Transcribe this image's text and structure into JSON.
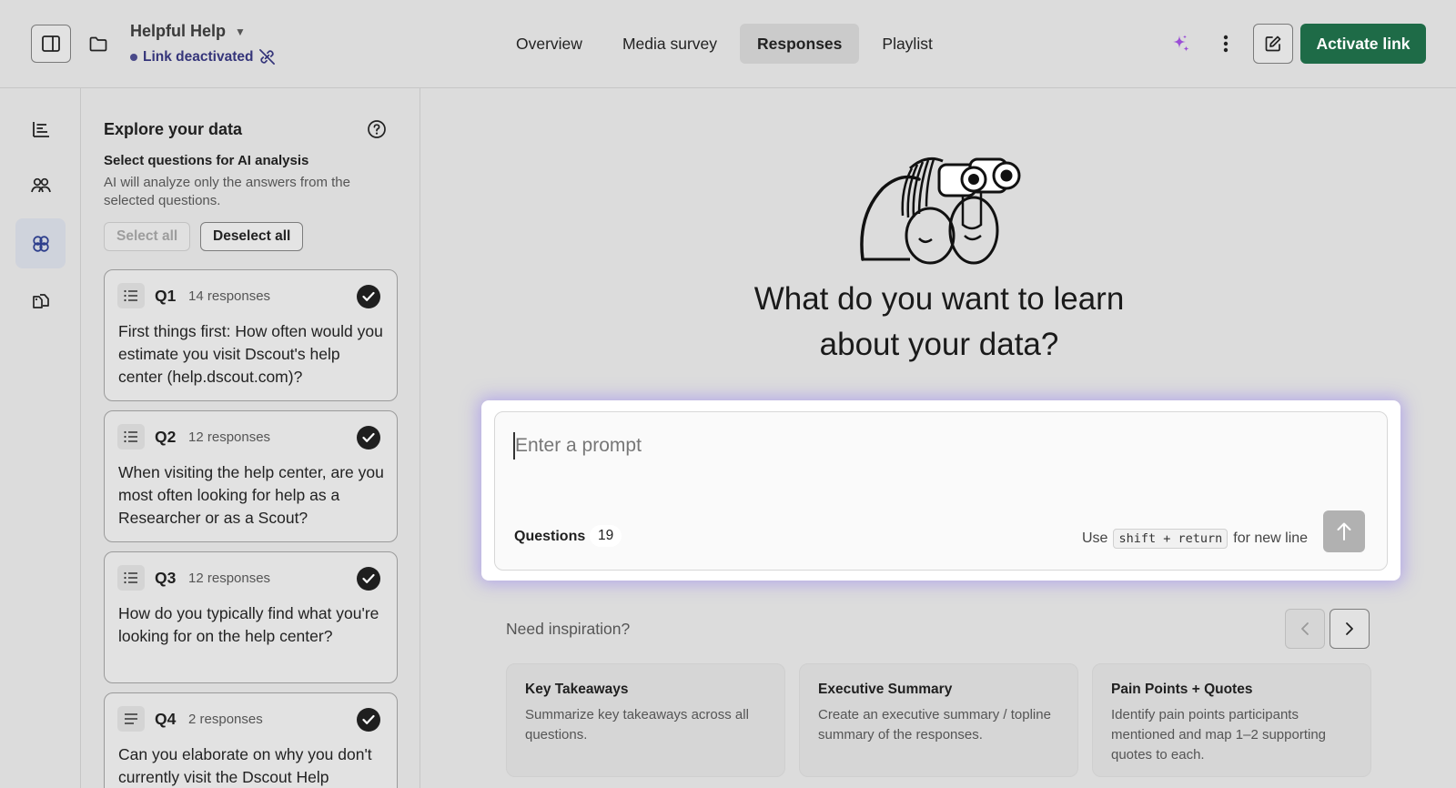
{
  "header": {
    "project_title": "Helpful Help",
    "link_status": "Link deactivated",
    "tabs": [
      {
        "label": "Overview",
        "active": false
      },
      {
        "label": "Media survey",
        "active": false
      },
      {
        "label": "Responses",
        "active": true
      },
      {
        "label": "Playlist",
        "active": false
      }
    ],
    "activate_label": "Activate link"
  },
  "sidebar": {
    "items": [
      {
        "icon": "bar-chart-icon",
        "active": false
      },
      {
        "icon": "people-icon",
        "active": false
      },
      {
        "icon": "ai-analysis-icon",
        "active": true
      },
      {
        "icon": "tags-icon",
        "active": false
      }
    ]
  },
  "explore": {
    "title": "Explore your data",
    "select_heading": "Select questions for AI analysis",
    "select_description": "AI will analyze only the answers from the selected questions.",
    "select_all_label": "Select all",
    "deselect_all_label": "Deselect all",
    "questions": [
      {
        "id": "Q1",
        "responses": "14 responses",
        "text": "First things first: How often would you estimate you visit Dscout's help center (help.dscout.com)?",
        "checked": true
      },
      {
        "id": "Q2",
        "responses": "12 responses",
        "text": "When visiting the help center, are you most often looking for help as a Researcher or as a Scout?",
        "checked": true
      },
      {
        "id": "Q3",
        "responses": "12 responses",
        "text": "How do you typically find what you're looking for on the help center?",
        "checked": true
      },
      {
        "id": "Q4",
        "responses": "2 responses",
        "text": "Can you elaborate on why you don't currently visit the Dscout Help",
        "checked": true
      }
    ]
  },
  "main": {
    "headline_line1": "What do you want to learn",
    "headline_line2": "about your data?",
    "prompt_placeholder": "Enter a prompt",
    "prompt_value": "",
    "questions_label": "Questions",
    "questions_count": "19",
    "hint_prefix": "Use",
    "hint_key": "shift + return",
    "hint_suffix": "for new line",
    "inspiration_label": "Need inspiration?",
    "suggestions": [
      {
        "title": "Key Takeaways",
        "body": "Summarize key takeaways across all questions."
      },
      {
        "title": "Executive Summary",
        "body": "Create an executive summary / topline summary of the responses."
      },
      {
        "title": "Pain Points + Quotes",
        "body": "Identify pain points participants mentioned and map 1–2 supporting quotes to each."
      }
    ]
  },
  "colors": {
    "accent_green": "#1e6b47",
    "sparkle_purple": "#9b4fd6",
    "prompt_glow": "#9682f0",
    "background": "#dcdcdc"
  }
}
